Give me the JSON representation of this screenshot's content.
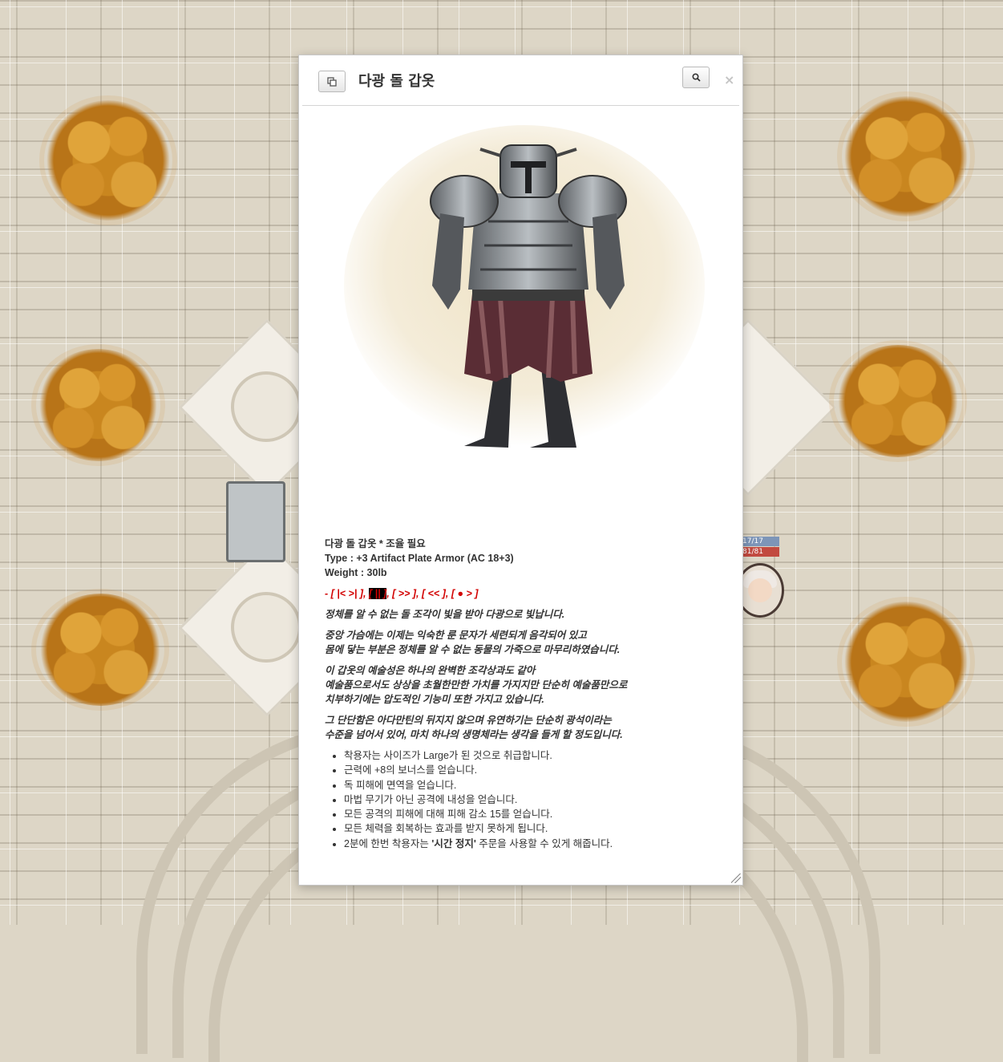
{
  "dialog": {
    "title": "다광 돌 갑옷",
    "copy_icon": "copy-icon",
    "zoom_icon": "search-icon",
    "close_label": "×"
  },
  "item": {
    "name_line": "다광 돌 갑옷 * 조율 필요",
    "type_line": "Type : +3 Artifact Plate Armor (AC 18+3)",
    "weight_line": "Weight : 30lb",
    "controls": {
      "prefix": "- ",
      "c1": "[ |<  >| ]",
      "sep1": ", ",
      "c2": "[ || ]",
      "sep2": ", ",
      "c3": "[ >> ]",
      "sep3": ", ",
      "c4": "[ << ]",
      "sep4": ", ",
      "c5": "[ ● > ]"
    },
    "desc": {
      "p1": "정체를 알 수 없는 돌 조각이 빛을 받아 다광으로 빛납니다.",
      "p2a": "중앙 가슴에는 이제는 익숙한 룬 문자가 세련되게 음각되어 있고",
      "p2b": "몸에 닿는 부분은 정체를 알 수 없는 동물의 가죽으로 마무리하였습니다.",
      "p3a": "이 갑옷의 예술성은 하나의 완벽한 조각상과도 같아",
      "p3b": "예술품으로서도 상상을 초월한만한 가치를 가지지만 단순히 예술품만으로",
      "p3c": "치부하기에는 압도적인 기능미 또한 가지고 있습니다.",
      "p4a": "그 단단함은 아다만틴의 뒤지지 않으며 유연하기는 단순히 광석이라는",
      "p4b": "수준을 넘어서 있어, 마치 하나의 생명체라는 생각을 들게 할 정도입니다."
    },
    "features": [
      "착용자는 사이즈가 Large가 된 것으로 취급합니다.",
      "근력에 +8의 보너스를 얻습니다.",
      "독 피해에 면역을 얻습니다.",
      "마법 무기가 아닌 공격에 내성을 얻습니다.",
      "모든 공격의 피해에 대해 피해 감소 15를 얻습니다.",
      "모든 체력을 회복하는 효과를 받지 못하게 됩니다."
    ],
    "last_feature": {
      "pre": "2분에 한번 착용자는 ",
      "bold": "'시간 정지'",
      "post": " 주문을 사용할 수 있게 해줍니다."
    }
  },
  "token": {
    "bar1": "17/17",
    "bar2": "81/81"
  }
}
